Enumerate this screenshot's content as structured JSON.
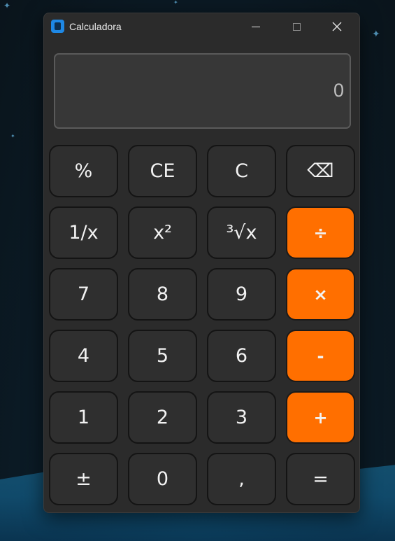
{
  "window": {
    "title": "Calculadora"
  },
  "display": {
    "value": "0"
  },
  "keys": [
    {
      "label": "%"
    },
    {
      "label": "CE"
    },
    {
      "label": "C"
    },
    {
      "label": "⌫"
    },
    {
      "label": "1/x"
    },
    {
      "label": "x²"
    },
    {
      "label": "³√x"
    },
    {
      "label": "÷"
    },
    {
      "label": "7"
    },
    {
      "label": "8"
    },
    {
      "label": "9"
    },
    {
      "label": "×"
    },
    {
      "label": "4"
    },
    {
      "label": "5"
    },
    {
      "label": "6"
    },
    {
      "label": "-"
    },
    {
      "label": "1"
    },
    {
      "label": "2"
    },
    {
      "label": "3"
    },
    {
      "label": "+"
    },
    {
      "label": "±"
    },
    {
      "label": "0"
    },
    {
      "label": ","
    },
    {
      "label": "="
    }
  ],
  "colors": {
    "operator_key": "#ff6f00",
    "key": "#2f2f2f",
    "window": "#2b2b2b"
  }
}
